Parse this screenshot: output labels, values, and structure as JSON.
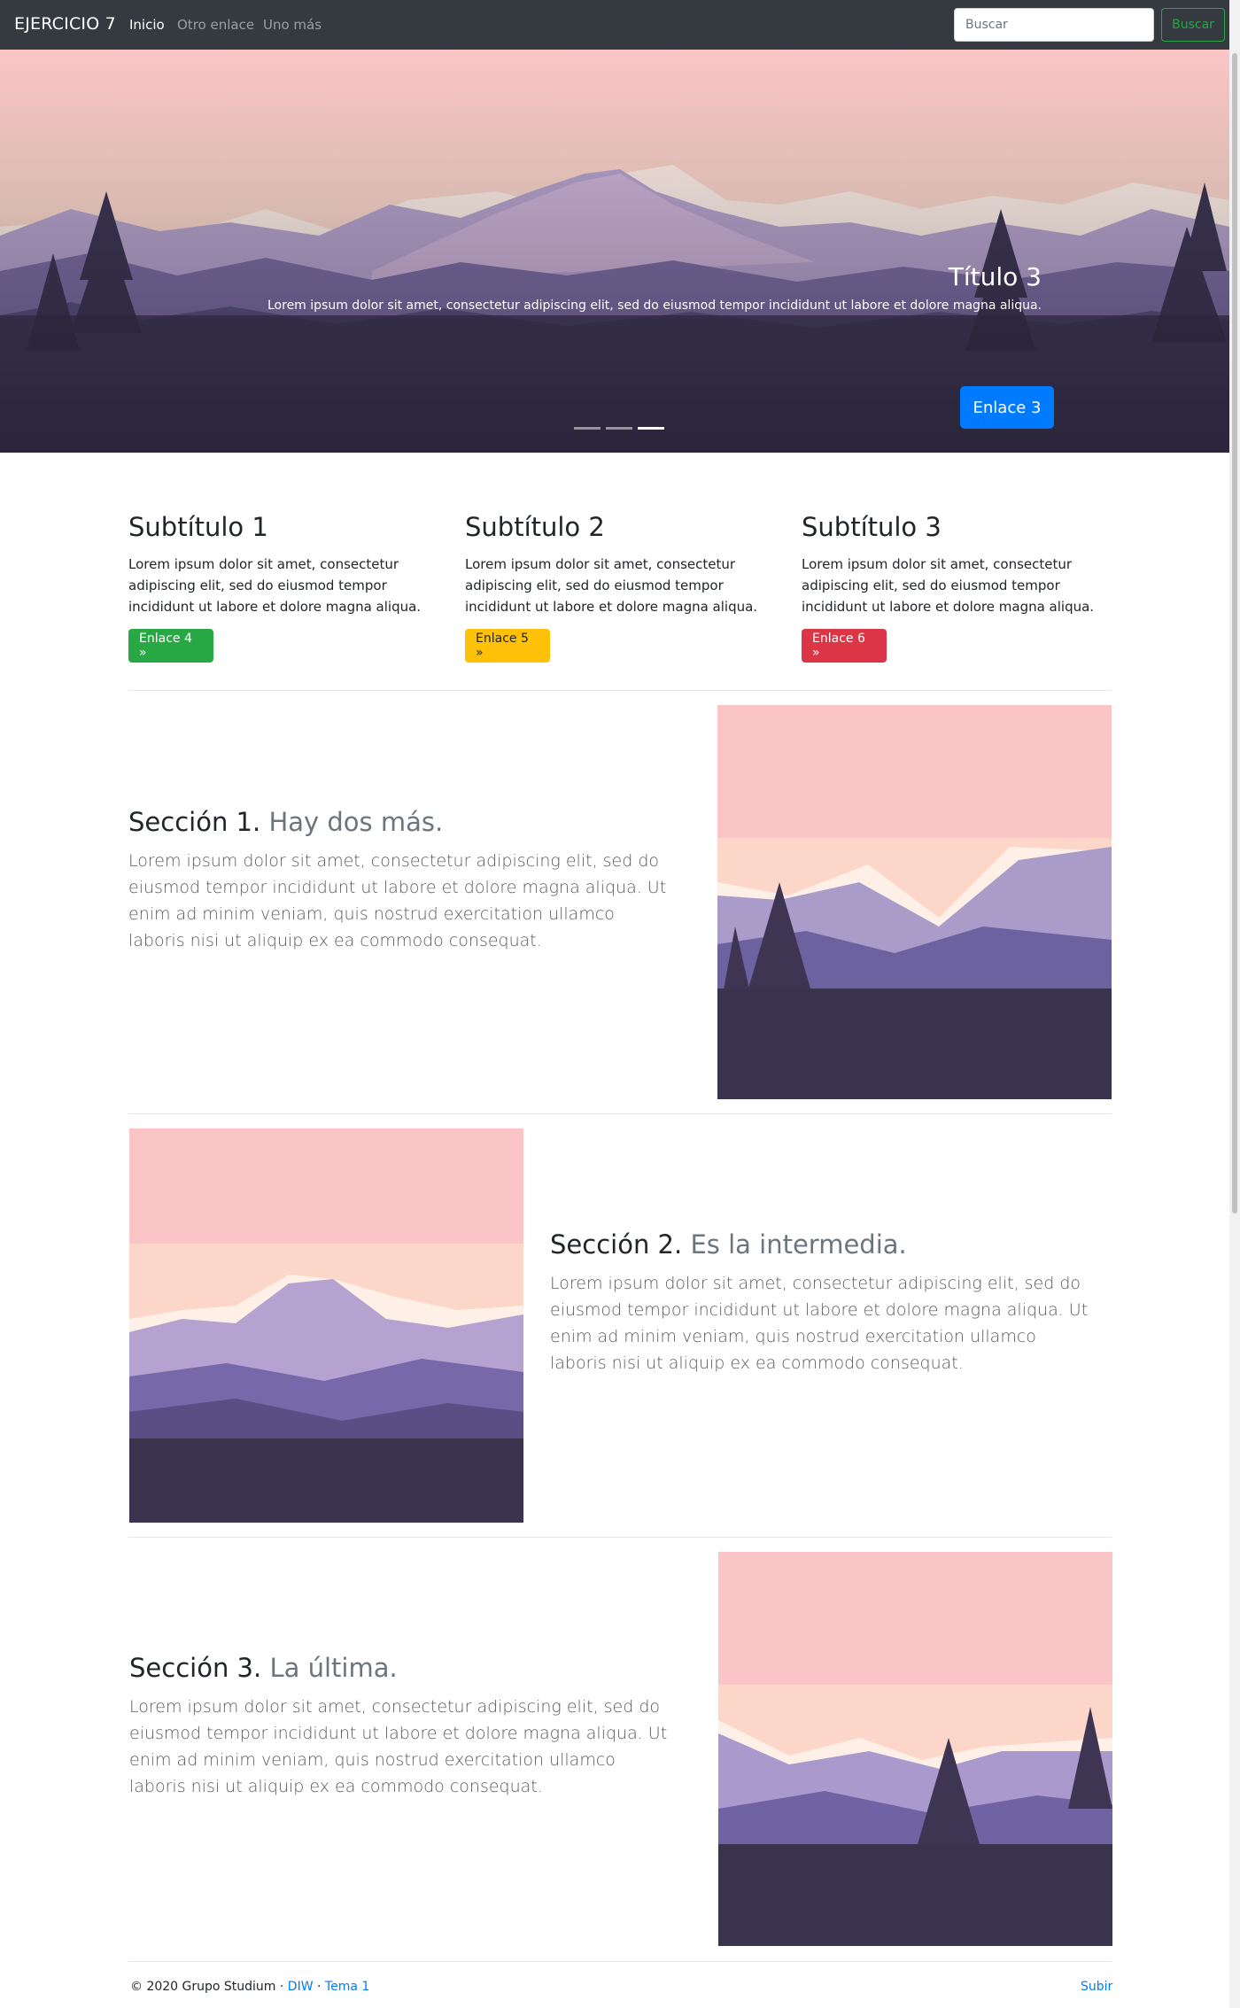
{
  "navbar": {
    "brand": "EJERCICIO 7",
    "links": [
      {
        "label": "Inicio",
        "active": true
      },
      {
        "label": "Otro enlace",
        "active": false
      },
      {
        "label": "Uno más",
        "active": false
      }
    ],
    "search_placeholder": "Buscar",
    "search_button": "Buscar"
  },
  "carousel": {
    "title": "Título 3",
    "text": "Lorem ipsum dolor sit amet, consectetur adipiscing elit, sed do eiusmod tempor incididunt ut labore et dolore magna aliqua.",
    "button": "Enlace 3",
    "slide_count": 3,
    "active_slide": 3
  },
  "columns": [
    {
      "title": "Subtítulo 1",
      "text": "Lorem ipsum dolor sit amet, consectetur adipiscing elit, sed do eiusmod tempor incididunt ut labore et dolore magna aliqua.",
      "button": "Enlace 4 »",
      "color": "#28a745"
    },
    {
      "title": "Subtítulo 2",
      "text": "Lorem ipsum dolor sit amet, consectetur adipiscing elit, sed do eiusmod tempor incididunt ut labore et dolore magna aliqua.",
      "button": "Enlace 5 »",
      "color": "#ffc107"
    },
    {
      "title": "Subtítulo 3",
      "text": "Lorem ipsum dolor sit amet, consectetur adipiscing elit, sed do eiusmod tempor incididunt ut labore et dolore magna aliqua.",
      "button": "Enlace 6 »",
      "color": "#dc3545"
    }
  ],
  "sections": [
    {
      "heading": "Sección 1.",
      "muted": "Hay dos más.",
      "text": "Lorem ipsum dolor sit amet, consectetur adipiscing elit, sed do eiusmod tempor incididunt ut labore et dolore magna aliqua. Ut enim ad minim veniam, quis nostrud exercitation ullamco laboris nisi ut aliquip ex ea commodo consequat."
    },
    {
      "heading": "Sección 2.",
      "muted": "Es la intermedia.",
      "text": "Lorem ipsum dolor sit amet, consectetur adipiscing elit, sed do eiusmod tempor incididunt ut labore et dolore magna aliqua. Ut enim ad minim veniam, quis nostrud exercitation ullamco laboris nisi ut aliquip ex ea commodo consequat."
    },
    {
      "heading": "Sección 3.",
      "muted": "La última.",
      "text": "Lorem ipsum dolor sit amet, consectetur adipiscing elit, sed do eiusmod tempor incididunt ut labore et dolore magna aliqua. Ut enim ad minim veniam, quis nostrud exercitation ullamco laboris nisi ut aliquip ex ea commodo consequat."
    }
  ],
  "footer": {
    "copyright": "© 2020 Grupo Studium · ",
    "link1": "DIW",
    "sep": " · ",
    "link2": "Tema 1",
    "back_to_top": "Subir"
  },
  "colors": {
    "navbar": "#343a40",
    "primary": "#007bff",
    "success": "#28a745",
    "warning": "#ffc107",
    "danger": "#dc3545"
  }
}
